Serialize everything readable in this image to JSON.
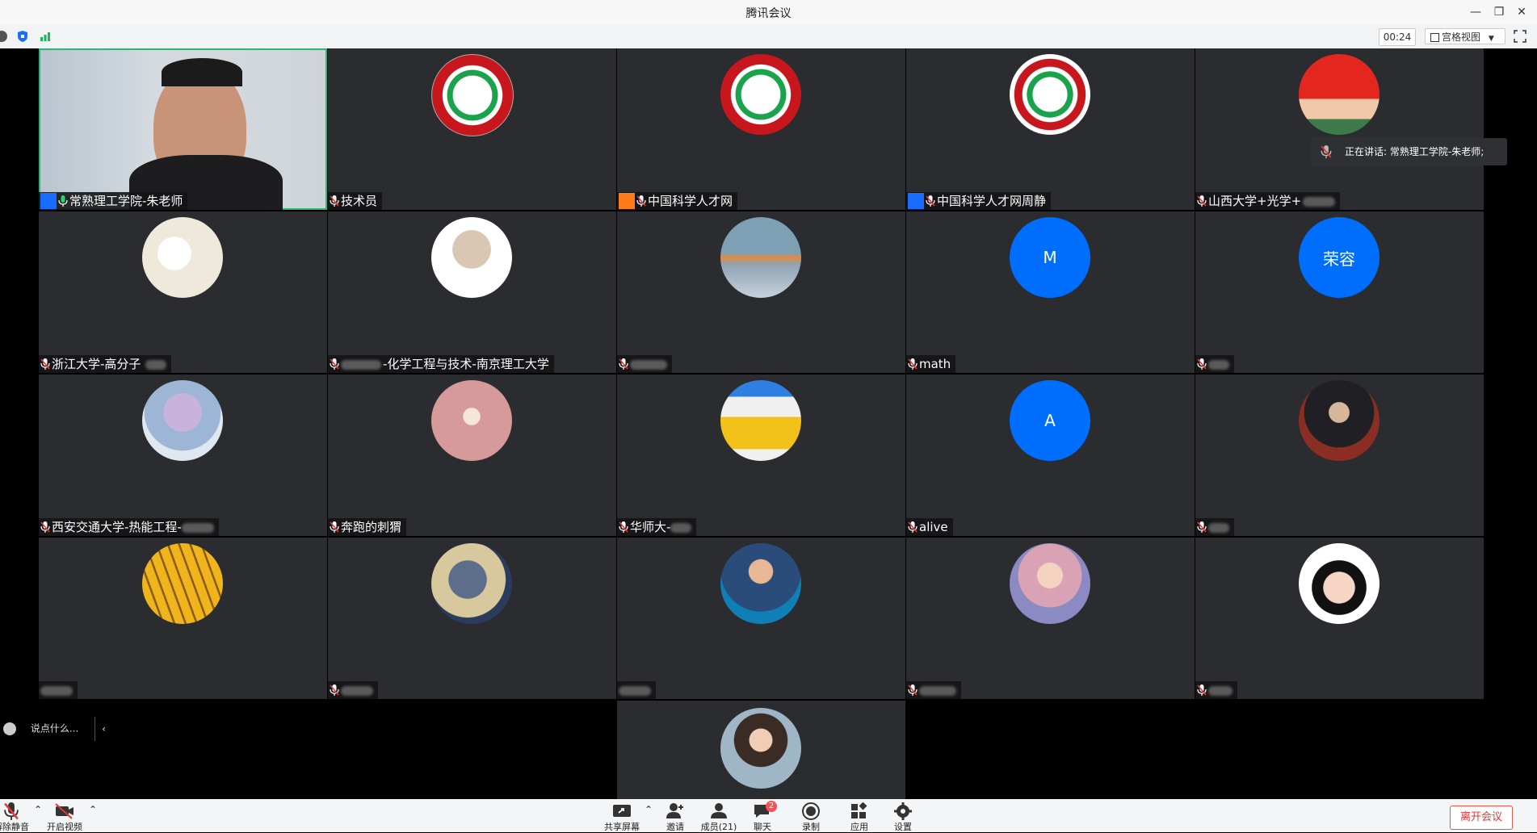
{
  "window": {
    "title": "腾讯会议"
  },
  "toolbar": {
    "timer": "00:24",
    "view_label": "宫格视图"
  },
  "speaking_toast": "正在讲话: 常熟理工学院-朱老师;",
  "chat": {
    "placeholder": "说点什么..."
  },
  "tiles": {
    "t0": {
      "name": "常熟理工学院-朱老师"
    },
    "t1": {
      "name": "技术员"
    },
    "t2": {
      "name": "中国科学人才网"
    },
    "t3": {
      "name": "中国科学人才网周静"
    },
    "t4": {
      "name": "山西大学+光学+"
    },
    "t5": {
      "name": "浙江大学-高分子"
    },
    "t6": {
      "name": "-化学工程与技术-南京理工大学"
    },
    "t7": {
      "name": ""
    },
    "t8": {
      "name": "math",
      "avatar_letter": "M"
    },
    "t9": {
      "name": "",
      "avatar_letter": "荣容"
    },
    "t10": {
      "name": "西安交通大学-热能工程-"
    },
    "t11": {
      "name": "奔跑的刺猬"
    },
    "t12": {
      "name": "华师大-"
    },
    "t13": {
      "name": "alive",
      "avatar_letter": "A"
    },
    "t14": {
      "name": ""
    },
    "t15": {
      "name": ""
    },
    "t16": {
      "name": ""
    },
    "t17": {
      "name": ""
    },
    "t18": {
      "name": ""
    },
    "t19": {
      "name": ""
    },
    "t20": {
      "name": ""
    }
  },
  "bottombar": {
    "mute": "解除静音",
    "video": "开启视频",
    "share": "共享屏幕",
    "invite": "邀请",
    "members": "成员(21)",
    "chat": "聊天",
    "chat_badge": "2",
    "record": "录制",
    "apps": "应用",
    "settings": "设置",
    "leave": "离开会议"
  },
  "colors": {
    "accent": "#1a6cff",
    "tile_bg": "#2b2c30",
    "leave": "#e33333"
  }
}
